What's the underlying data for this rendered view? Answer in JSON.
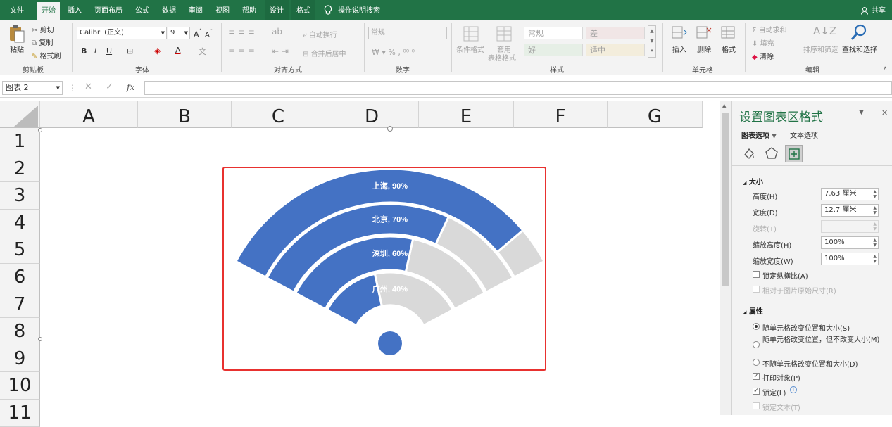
{
  "tabs": [
    "文件",
    "开始",
    "插入",
    "页面布局",
    "公式",
    "数据",
    "审阅",
    "视图",
    "帮助",
    "设计",
    "格式"
  ],
  "tell_me": "操作说明搜索",
  "share": "共享",
  "clipboard": {
    "paste": "粘贴",
    "cut": "剪切",
    "copy": "复制",
    "format_painter": "格式刷",
    "label": "剪贴板"
  },
  "font": {
    "name": "Calibri (正文)",
    "size": "9",
    "label": "字体"
  },
  "alignment": {
    "wrap": "自动换行",
    "merge": "合并后居中",
    "label": "对齐方式"
  },
  "number": {
    "format": "常规",
    "label": "数字"
  },
  "styles": {
    "cond": "条件格式",
    "table1": "套用",
    "table2": "表格格式",
    "cells": [
      "常规",
      "差",
      "好",
      "适中"
    ],
    "label": "样式"
  },
  "cells_group": {
    "insert": "插入",
    "delete": "删除",
    "format": "格式",
    "label": "单元格"
  },
  "editing": {
    "autosum": "自动求和",
    "fill": "填充",
    "clear": "清除",
    "sort": "排序和筛选",
    "find": "查找和选择",
    "label": "编辑"
  },
  "name_box": "图表 2",
  "fx": "fx",
  "columns": [
    "A",
    "B",
    "C",
    "D",
    "E",
    "F",
    "G"
  ],
  "rows": [
    "1",
    "2",
    "3",
    "4",
    "5",
    "6",
    "7",
    "8",
    "9",
    "10",
    "11"
  ],
  "chart_data": {
    "type": "radial-bar",
    "categories": [
      "广州",
      "深圳",
      "北京",
      "上海"
    ],
    "values": [
      40,
      60,
      70,
      90
    ],
    "max": 100,
    "data_labels": [
      "广州, 40%",
      "深圳, 60%",
      "北京, 70%",
      "上海, 90%"
    ],
    "colors": {
      "value": "#4472C4",
      "remainder": "#D9D9D9",
      "border": "#E8312F"
    }
  },
  "pane": {
    "title": "设置图表区格式",
    "tab_chart": "图表选项",
    "tab_text": "文本选项",
    "size_header": "大小",
    "height_label": "高度(H)",
    "height_value": "7.63 厘米",
    "width_label": "宽度(D)",
    "width_value": "12.7 厘米",
    "rotate_label": "旋转(T)",
    "scale_h_label": "缩放高度(H)",
    "scale_h_value": "100%",
    "scale_w_label": "缩放宽度(W)",
    "scale_w_value": "100%",
    "lock_ratio": "锁定纵横比(A)",
    "relative_orig": "相对于图片原始尺寸(R)",
    "props_header": "属性",
    "opt1": "随单元格改变位置和大小(S)",
    "opt2": "随单元格改变位置，但不改变大小(M)",
    "opt3": "不随单元格改变位置和大小(D)",
    "print_obj": "打印对象(P)",
    "locked": "锁定(L)",
    "lock_text": "锁定文本(T)"
  }
}
